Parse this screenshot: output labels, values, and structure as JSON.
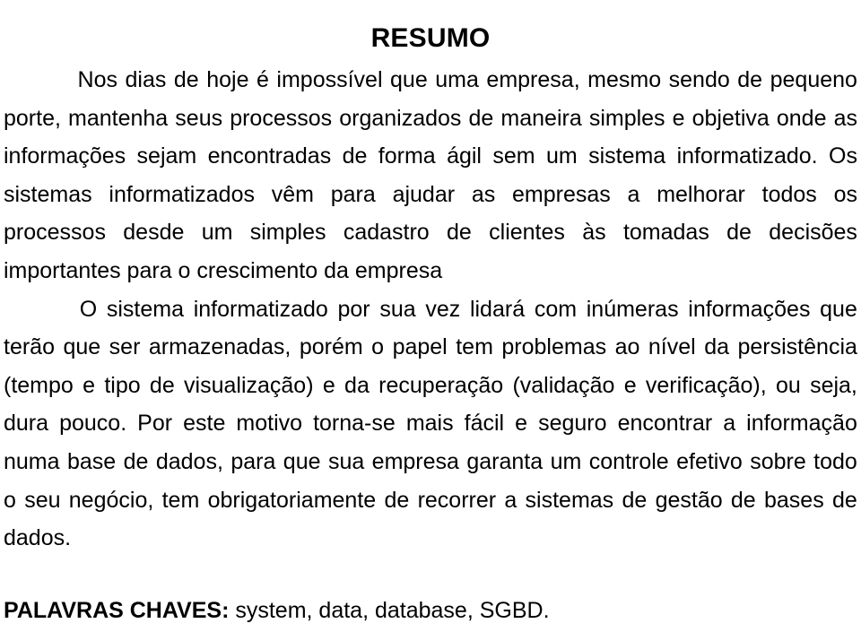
{
  "document": {
    "title": "RESUMO",
    "background_color": "#ffffff",
    "text_color": "#000000",
    "language": "pt-BR",
    "alignment": "justified",
    "paragraphs": [
      {
        "id": "paragraph-1",
        "indented": true,
        "text": "Nos dias de hoje é impossível que uma empresa, mesmo sendo de pequeno porte, mantenha seus processos organizados de maneira simples e objetiva onde as informações sejam encontradas de forma ágil sem um sistema informatizado. Os sistemas informatizados vêm para ajudar as empresas a melhorar todos os processos desde um simples cadastro de clientes às tomadas de decisões importantes para o crescimento da empresa",
        "lines": [
          {
            "indent": true,
            "justified": true,
            "words": [
              "Nos",
              "dias",
              "de",
              "hoje",
              "é",
              "impossível",
              "que",
              "uma",
              "empresa,",
              "mesmo",
              "sendo",
              "de",
              "pequeno"
            ]
          },
          {
            "indent": false,
            "justified": true,
            "words": [
              "porte,",
              "mantenha",
              "seus",
              "processos",
              "organizados",
              "de",
              "maneira",
              "simples",
              "e",
              "objetiva",
              "onde",
              "as"
            ]
          },
          {
            "indent": false,
            "justified": true,
            "words": [
              "informações",
              "sejam",
              "encontradas",
              "de",
              "forma",
              "ágil",
              "sem",
              "um",
              "sistema",
              "informatizado.",
              "Os"
            ]
          },
          {
            "indent": false,
            "justified": true,
            "words": [
              "sistemas",
              "informatizados",
              "vêm",
              "para",
              "ajudar",
              "as",
              "empresas",
              "a",
              "melhorar",
              "todos",
              "os"
            ]
          },
          {
            "indent": false,
            "justified": true,
            "words": [
              "processos",
              "desde",
              "um",
              "simples",
              "cadastro",
              "de",
              "clientes",
              "às",
              "tomadas",
              "de",
              "decisões"
            ]
          },
          {
            "indent": false,
            "justified": false,
            "text": "importantes para o crescimento da empresa"
          }
        ]
      },
      {
        "id": "paragraph-2",
        "indented": true,
        "text": "O sistema informatizado por sua vez lidará com inúmeras informações que terão que ser armazenadas, porém o papel tem problemas ao nível da persistência (tempo e tipo de visualização) e da recuperação (validação e verificação), ou seja, dura pouco. Por este motivo torna-se mais fácil e seguro encontrar a informação numa base de dados, para que sua empresa garanta um controle efetivo sobre todo o seu negócio, tem obrigatoriamente de recorrer a sistemas de gestão de bases de dados.",
        "lines": [
          {
            "indent": true,
            "justified": true,
            "words": [
              "O",
              "sistema",
              "informatizado",
              "por",
              "sua",
              "vez",
              "lidará",
              "com",
              "inúmeras",
              "informações",
              "que"
            ]
          },
          {
            "indent": false,
            "justified": true,
            "words": [
              "terão",
              "que",
              "ser",
              "armazenadas,",
              "porém",
              "o",
              "papel",
              "tem",
              "problemas",
              "ao",
              "nível",
              "da",
              "persistência"
            ]
          },
          {
            "indent": false,
            "justified": true,
            "words": [
              "(tempo",
              "e",
              "tipo",
              "de",
              "visualização)",
              "e",
              "da",
              "recuperação",
              "(validação",
              "e",
              "verificação),",
              "ou",
              "seja,"
            ]
          },
          {
            "indent": false,
            "justified": true,
            "words": [
              "dura",
              "pouco.",
              "Por",
              "este",
              "motivo",
              "torna-se",
              "mais",
              "fácil",
              "e",
              "seguro",
              "encontrar",
              "a",
              "informação"
            ]
          },
          {
            "indent": false,
            "justified": true,
            "words": [
              "numa",
              "base",
              "de",
              "dados,",
              "para",
              "que",
              "sua",
              "empresa",
              "garanta",
              "um",
              "controle",
              "efetivo",
              "sobre",
              "todo"
            ]
          },
          {
            "indent": false,
            "justified": true,
            "words": [
              "o",
              "seu",
              "negócio,",
              "tem",
              "obrigatoriamente",
              "de",
              "recorrer",
              "a",
              "sistemas",
              "de",
              "gestão",
              "de",
              "bases",
              "de"
            ]
          },
          {
            "indent": false,
            "justified": false,
            "text": "dados."
          }
        ]
      }
    ],
    "keywords": {
      "label": "PALAVRAS CHAVES:",
      "values": " system, data, database, SGBD.",
      "items": [
        "system",
        "data",
        "database",
        "SGBD"
      ]
    }
  }
}
